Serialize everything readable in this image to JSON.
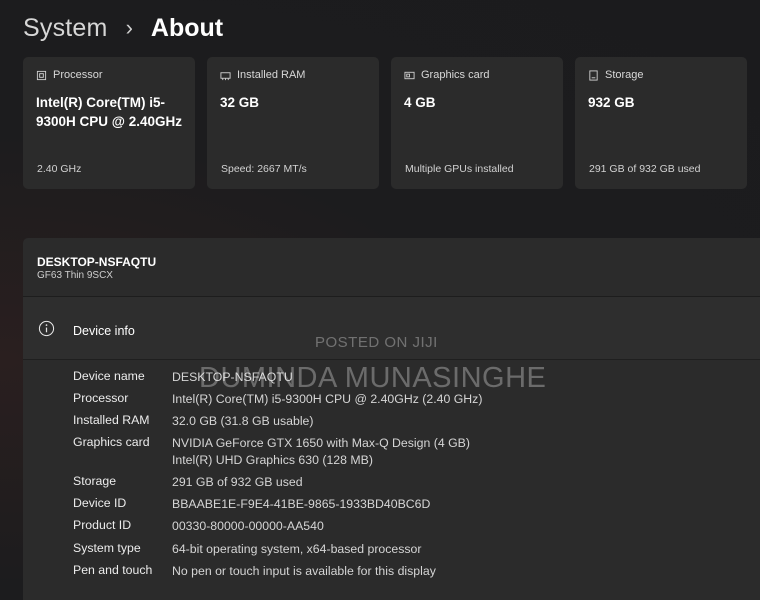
{
  "breadcrumb": {
    "parent": "System",
    "separator": "›",
    "current": "About"
  },
  "cards": [
    {
      "title": "Processor",
      "value": "Intel(R) Core(TM) i5-9300H CPU @ 2.40GHz",
      "sub": "2.40 GHz",
      "icon": "processor-icon"
    },
    {
      "title": "Installed RAM",
      "value": "32 GB",
      "sub": "Speed: 2667 MT/s",
      "icon": "ram-icon"
    },
    {
      "title": "Graphics card",
      "value": "4 GB",
      "sub": "Multiple GPUs installed",
      "icon": "graphics-card-icon"
    },
    {
      "title": "Storage",
      "value": "932 GB",
      "sub": "291 GB of 932 GB used",
      "icon": "storage-icon"
    }
  ],
  "device": {
    "name": "DESKTOP-NSFAQTU",
    "model": "GF63 Thin 9SCX"
  },
  "device_info": {
    "title": "Device info",
    "rows": [
      {
        "label": "Device name",
        "value": "DESKTOP-NSFAQTU"
      },
      {
        "label": "Processor",
        "value": "Intel(R) Core(TM) i5-9300H CPU @ 2.40GHz (2.40 GHz)"
      },
      {
        "label": "Installed RAM",
        "value": "32.0 GB (31.8 GB usable)"
      },
      {
        "label": "Graphics card",
        "value": "NVIDIA GeForce GTX 1650 with Max-Q Design (4 GB)",
        "value2": "Intel(R) UHD Graphics 630 (128 MB)"
      },
      {
        "label": "Storage",
        "value": "291 GB of 932 GB used"
      },
      {
        "label": "Device ID",
        "value": "BBAABE1E-F9E4-41BE-9865-1933BD40BC6D"
      },
      {
        "label": "Product ID",
        "value": "00330-80000-00000-AA540"
      },
      {
        "label": "System type",
        "value": "64-bit operating system, x64-based processor"
      },
      {
        "label": "Pen and touch",
        "value": "No pen or touch input is available for this display"
      }
    ]
  },
  "watermark": {
    "line1": "POSTED ON JIJI",
    "line2": "DUMINDA MUNASINGHE"
  },
  "colors": {
    "background": "#1c1c1e",
    "card": "#2b2b2b",
    "text": "#ffffff"
  }
}
